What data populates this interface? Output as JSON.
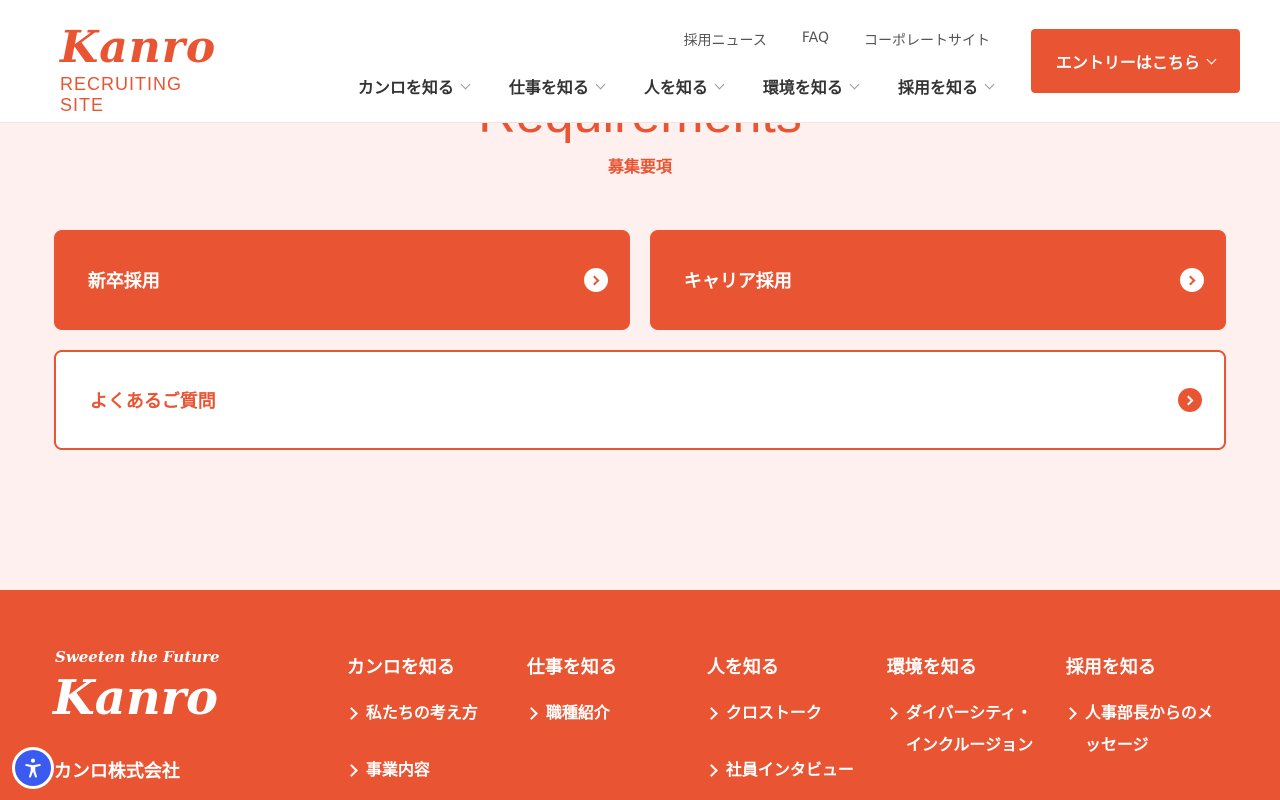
{
  "header": {
    "logo_main": "Kanro",
    "logo_sub": "RECRUITING SITE",
    "subnav": [
      "採用ニュース",
      "FAQ",
      "コーポレートサイト"
    ],
    "mainnav": [
      "カンロを知る",
      "仕事を知る",
      "人を知る",
      "環境を知る",
      "採用を知る"
    ],
    "entry_label": "エントリーはこちら"
  },
  "requirements": {
    "title": "Requirements",
    "subtitle": "募集要項",
    "cards": [
      "新卒採用",
      "キャリア採用",
      "よくあるご質問"
    ]
  },
  "footer": {
    "tagline": "Sweeten the Future",
    "logo": "Kanro",
    "company": "カンロ株式会社",
    "columns": [
      {
        "title": "カンロを知る",
        "links": [
          "私たちの考え方",
          "事業内容"
        ]
      },
      {
        "title": "仕事を知る",
        "links": [
          "職種紹介"
        ]
      },
      {
        "title": "人を知る",
        "links": [
          "クロストーク",
          "社員インタビュー"
        ]
      },
      {
        "title": "環境を知る",
        "links": [
          "ダイバーシティ・インクルージョン"
        ]
      },
      {
        "title": "採用を知る",
        "links": [
          "人事部長からのメッセージ"
        ]
      }
    ]
  },
  "colors": {
    "brand": "#e95532",
    "background": "#fdf0ef",
    "accessibility": "#3b5bf0"
  },
  "icons": {
    "card_arrow": "chevron-right-circle-icon",
    "accessibility": "accessibility-icon"
  }
}
